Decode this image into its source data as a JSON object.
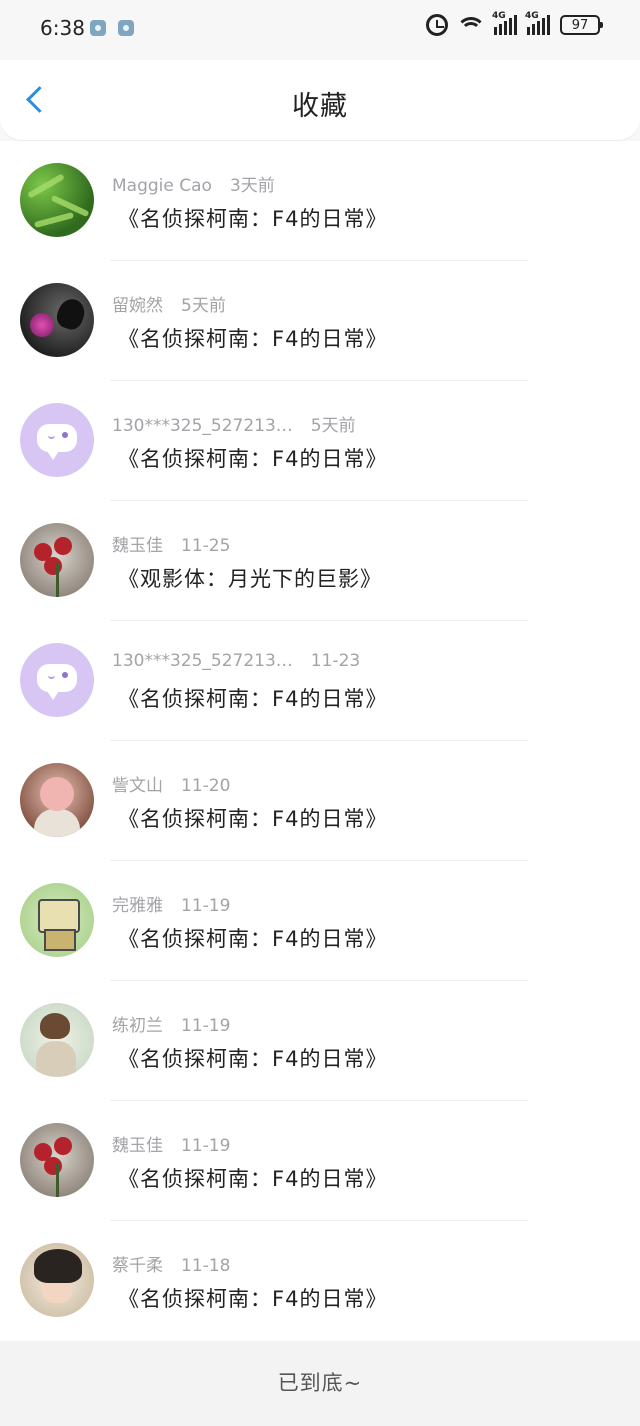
{
  "status_bar": {
    "time": "6:38",
    "network_1": "4G",
    "network_2": "4G",
    "battery": "97"
  },
  "header": {
    "title": "收藏"
  },
  "items": [
    {
      "user": "Maggie Cao",
      "time": "3天前",
      "work": "《名侦探柯南：F4的日常》",
      "avatar": "bamboo-avatar"
    },
    {
      "user": "留婉然",
      "time": "5天前",
      "work": "《名侦探柯南：F4的日常》",
      "avatar": "butterfly-avatar"
    },
    {
      "user": "130***325_527213…",
      "time": "5天前",
      "work": "《名侦探柯南：F4的日常》",
      "avatar": "default-avatar"
    },
    {
      "user": "魏玉佳",
      "time": "11-25",
      "work": "《观影体：月光下的巨影》",
      "avatar": "flower-avatar"
    },
    {
      "user": "130***325_527213…",
      "time": "11-23",
      "work": "《名侦探柯南：F4的日常》",
      "avatar": "default-avatar"
    },
    {
      "user": "訾文山",
      "time": "11-20",
      "work": "《名侦探柯南：F4的日常》",
      "avatar": "baby-avatar"
    },
    {
      "user": "完雅雅",
      "time": "11-19",
      "work": "《名侦探柯南：F4的日常》",
      "avatar": "robot-avatar"
    },
    {
      "user": "练初兰",
      "time": "11-19",
      "work": "《名侦探柯南：F4的日常》",
      "avatar": "boy-avatar"
    },
    {
      "user": "魏玉佳",
      "time": "11-19",
      "work": "《名侦探柯南：F4的日常》",
      "avatar": "flower-avatar"
    },
    {
      "user": "蔡千柔",
      "time": "11-18",
      "work": "《名侦探柯南：F4的日常》",
      "avatar": "anime-avatar"
    }
  ],
  "footer": {
    "text": "已到底~"
  },
  "colors": {
    "accent": "#2a8ce6",
    "meta_text": "#a3a3a8",
    "default_avatar": "#d7c6f4"
  }
}
